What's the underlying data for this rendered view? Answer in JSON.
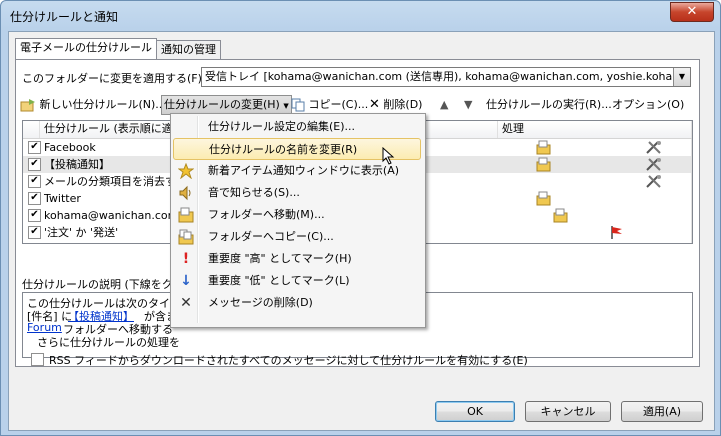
{
  "window": {
    "title": "仕分けルールと通知",
    "close": "✕"
  },
  "tabs": [
    {
      "label": "電子メールの仕分けルール"
    },
    {
      "label": "通知の管理"
    }
  ],
  "folder": {
    "label": "このフォルダーに変更を適用する(F):",
    "value": "受信トレイ [kohama@wanichan.com (送信専用), kohama@wanichan.com, yoshie.kohama@wanichan.com]"
  },
  "toolbar": {
    "new_rule": "新しい仕分けルール(N)...",
    "change_rule": "仕分けルールの変更(H)",
    "copy": "コピー(C)...",
    "delete": "削除(D)",
    "run_rules": "仕分けルールの実行(R)...",
    "options": "オプション(O)"
  },
  "list": {
    "headers": [
      "仕分けルール (表示順に適用されます)",
      "処理"
    ],
    "rows": [
      {
        "name": "Facebook",
        "checked": "✔"
      },
      {
        "name": "【投稿通知】",
        "checked": "✔"
      },
      {
        "name": "メールの分類項目を消去す",
        "checked": "✔"
      },
      {
        "name": "Twitter",
        "checked": "✔"
      },
      {
        "name": "kohama@wanichan.com (",
        "checked": "✔"
      },
      {
        "name": "'注文' か '発送'",
        "checked": "✔"
      }
    ]
  },
  "description": {
    "label": "仕分けルールの説明 (下線をク",
    "lines": [
      "この仕分けルールは次のタイミ",
      "[件名] に",
      "【投稿通知】",
      "が含ま",
      "Forum",
      "フォルダーへ移動する",
      "さらに仕分けルールの処理を"
    ]
  },
  "rss": {
    "label": "RSS フィードからダウンロードされたすべてのメッセージに対して仕分けルールを有効にする(E)"
  },
  "buttons": {
    "ok": "OK",
    "cancel": "キャンセル",
    "apply": "適用(A)"
  },
  "menu": {
    "items": [
      {
        "label": "仕分けルール設定の編集(E)...",
        "icon": "none"
      },
      {
        "label": "仕分けルールの名前を変更(R)",
        "icon": "none"
      },
      {
        "label": "新着アイテム通知ウィンドウに表示(A)",
        "icon": "star-icon"
      },
      {
        "label": "音で知らせる(S)...",
        "icon": "speaker-icon"
      },
      {
        "label": "フォルダーへ移動(M)...",
        "icon": "move-folder-icon"
      },
      {
        "label": "フォルダーへコピー(C)...",
        "icon": "copy-folder-icon"
      },
      {
        "label": "重要度 \"高\" としてマーク(H)",
        "icon": "exclamation-icon"
      },
      {
        "label": "重要度 \"低\" としてマーク(L)",
        "icon": "down-arrow-icon"
      },
      {
        "label": "メッセージの削除(D)",
        "icon": "delete-x-icon"
      }
    ]
  },
  "colors": {
    "accent": "#3c7fb1",
    "menu_highlight": "#fcecb1",
    "link": "#0033cc"
  }
}
